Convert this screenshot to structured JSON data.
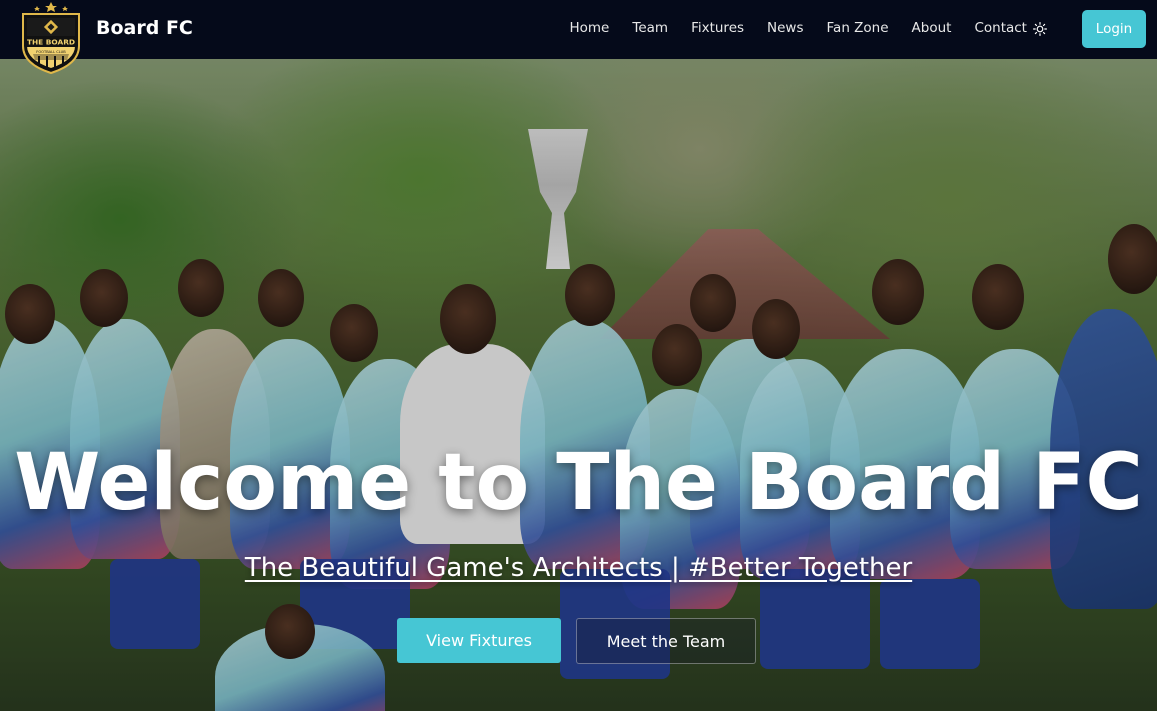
{
  "navbar": {
    "brand": "Board FC",
    "logo": {
      "icon": "club-crest-icon",
      "text_main": "THE BOARD",
      "text_sub": "FOOTBALL CLUB"
    },
    "links": [
      "Home",
      "Team",
      "Fixtures",
      "News",
      "Fan Zone",
      "About",
      "Contact"
    ],
    "theme_icon": "sun-icon",
    "login_label": "Login"
  },
  "hero": {
    "title": "Welcome to The Board FC",
    "subtitle": "The Beautiful Game's Architects | #Better Together",
    "primary_button": "View Fixtures",
    "secondary_button": "Meet the Team"
  },
  "colors": {
    "navbar_bg": "#050a1a",
    "accent": "#46c6d4",
    "hero_text": "#ffffff"
  }
}
